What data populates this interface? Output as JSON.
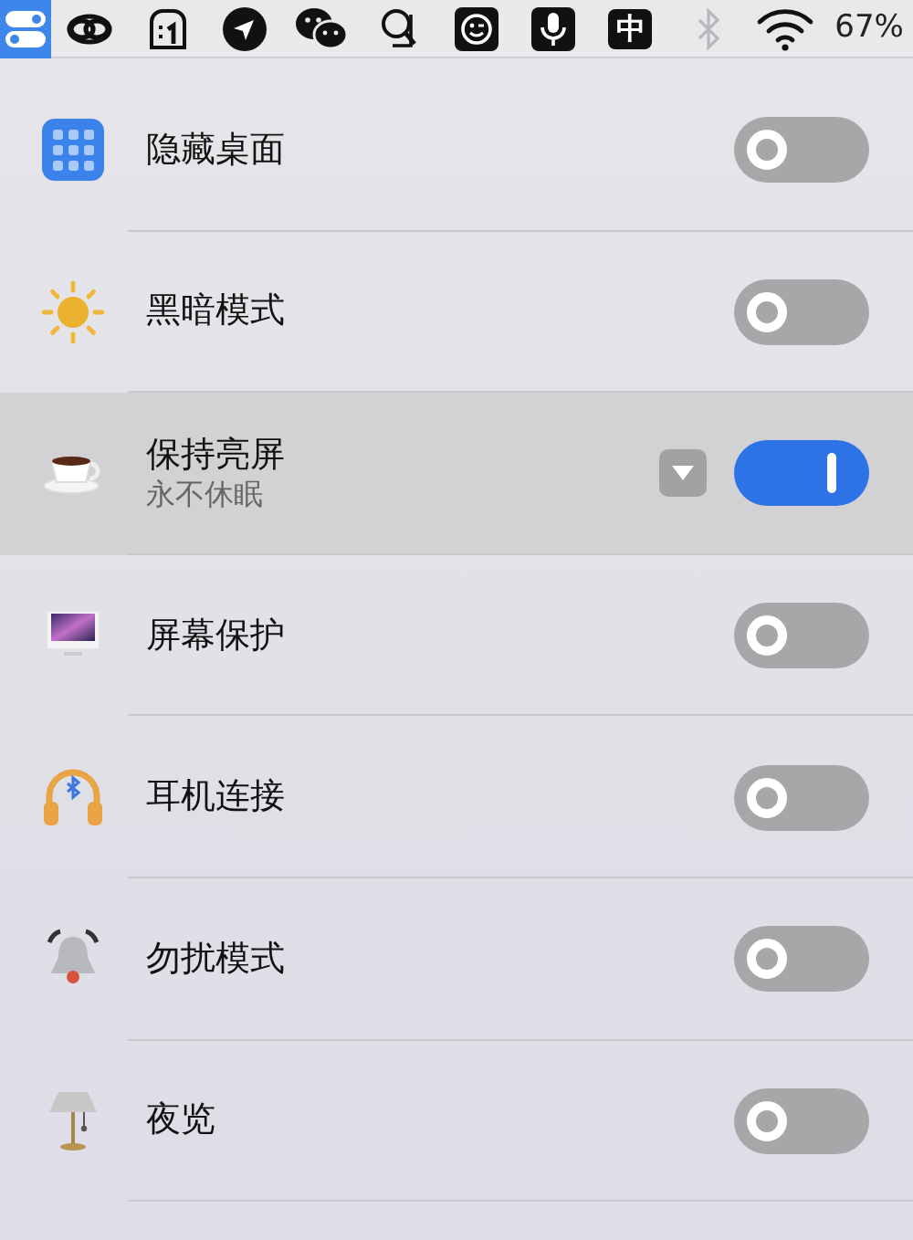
{
  "menu_bar": {
    "input_method": "中",
    "bluetooth": {
      "disabled": true
    },
    "battery": "67%"
  },
  "items": [
    {
      "label": "隐藏桌面",
      "on": false,
      "selected": false
    },
    {
      "label": "黑暗模式",
      "on": false,
      "selected": false
    },
    {
      "label": "保持亮屏",
      "sublabel": "永不休眠",
      "on": true,
      "selected": true,
      "dropdown": true
    },
    {
      "label": "屏幕保护",
      "on": false,
      "selected": false
    },
    {
      "label": "耳机连接",
      "on": false,
      "selected": false
    },
    {
      "label": "勿扰模式",
      "on": false,
      "selected": false
    },
    {
      "label": "夜览",
      "on": false,
      "selected": false
    }
  ]
}
